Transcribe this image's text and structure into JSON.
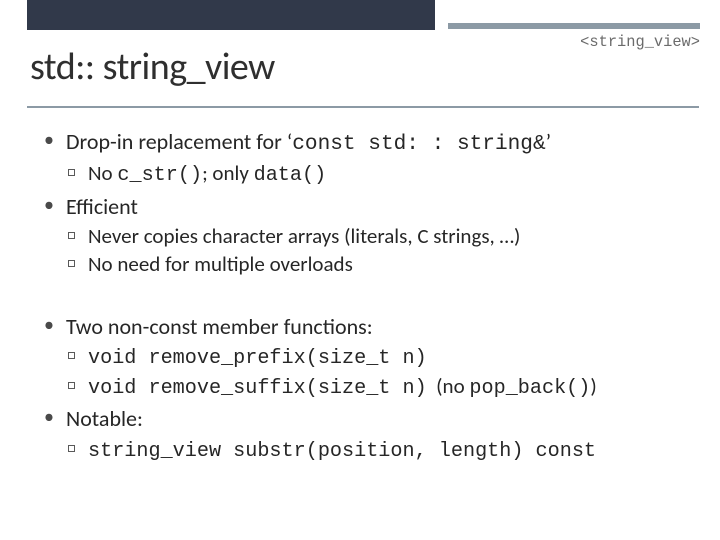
{
  "header": {
    "tag": "<string_view>",
    "title_a": "std:",
    "title_b": ":",
    "title_c": "string_view"
  },
  "b1": {
    "pre": "Drop-in replacement for ‘",
    "code": "const std: : string&",
    "post": "’"
  },
  "b1s1": {
    "pre": "No ",
    "code1": "c_str()",
    "mid": "; only ",
    "code2": "data()"
  },
  "b2": {
    "text": "Efficient"
  },
  "b2s1": {
    "text": "Never copies character arrays (literals, C strings, …)"
  },
  "b2s2": {
    "text": "No need for multiple overloads"
  },
  "b3": {
    "text": "Two non-const member functions:"
  },
  "b3s1": {
    "code": "void remove_prefix(size_t n)"
  },
  "b3s2": {
    "code": "void remove_suffix(size_t n)",
    "tail_pre": "  (no ",
    "tail_code": "pop_back()",
    "tail_post": ")"
  },
  "b4": {
    "text": "Notable:"
  },
  "b4s1": {
    "code": "string_view substr(position, length) const"
  }
}
